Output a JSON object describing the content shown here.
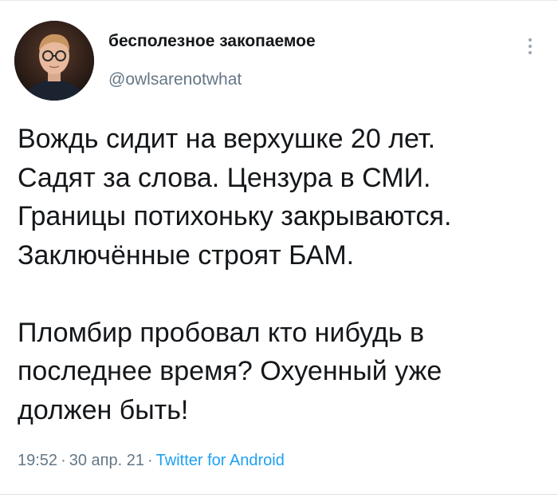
{
  "author": {
    "display_name": "бесполезное закопаемое",
    "handle": "@owlsarenotwhat",
    "avatar_icon": "user-avatar-photo"
  },
  "menu": {
    "icon": "more-vertical-icon"
  },
  "tweet": {
    "lines": [
      "Вождь сидит на верхушке 20 лет.",
      "Садят за слова. Цензура в СМИ.",
      "Границы потихоньку закрываются.",
      "Заключённые строят БАМ.",
      "",
      "Пломбир пробовал кто нибудь в",
      "последнее время? Охуенный уже",
      "должен быть!"
    ]
  },
  "meta": {
    "time": "19:52",
    "separator": "·",
    "date": "30 апр. 21",
    "source": "Twitter for Android"
  },
  "colors": {
    "text": "#14171a",
    "secondary": "#657786",
    "link": "#1da1f2",
    "divider": "#e0e0e0"
  }
}
